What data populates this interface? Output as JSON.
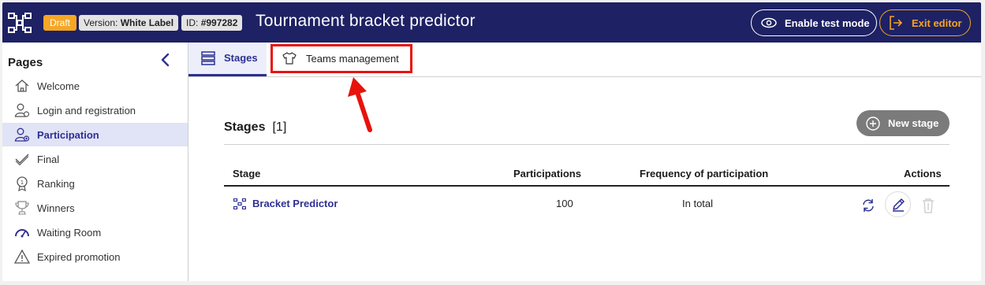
{
  "header": {
    "draft_badge": "Draft",
    "version_prefix": "Version:",
    "version_value": "White Label",
    "id_prefix": "ID:",
    "id_value": "#997282",
    "title": "Tournament bracket predictor",
    "test_mode_label": "Enable test mode",
    "exit_label": "Exit editor"
  },
  "sidebar": {
    "title": "Pages",
    "items": [
      {
        "label": "Welcome",
        "icon": "home-icon",
        "active": false
      },
      {
        "label": "Login and registration",
        "icon": "user-login-icon",
        "active": false
      },
      {
        "label": "Participation",
        "icon": "user-participation-icon",
        "active": true
      },
      {
        "label": "Final",
        "icon": "check-icon",
        "active": false
      },
      {
        "label": "Ranking",
        "icon": "medal-icon",
        "active": false
      },
      {
        "label": "Winners",
        "icon": "trophy-icon",
        "active": false
      },
      {
        "label": "Waiting Room",
        "icon": "gauge-icon",
        "active": false
      },
      {
        "label": "Expired promotion",
        "icon": "warning-icon",
        "active": false
      }
    ]
  },
  "tabs": [
    {
      "label": "Stages",
      "icon": "list-icon",
      "active": true
    },
    {
      "label": "Teams management",
      "icon": "shirt-icon",
      "active": false
    }
  ],
  "stages_section": {
    "title": "Stages",
    "count": "[1]",
    "new_stage_label": "New stage",
    "columns": [
      "Stage",
      "Participations",
      "Frequency of participation",
      "Actions"
    ],
    "rows": [
      {
        "stage": "Bracket Predictor",
        "participations": "100",
        "frequency": "In total"
      }
    ]
  },
  "colors": {
    "header_bg": "#1e2163",
    "accent": "#2d3092",
    "draft": "#f5a623",
    "exit": "#f5a623",
    "highlight": "#e8120c"
  }
}
